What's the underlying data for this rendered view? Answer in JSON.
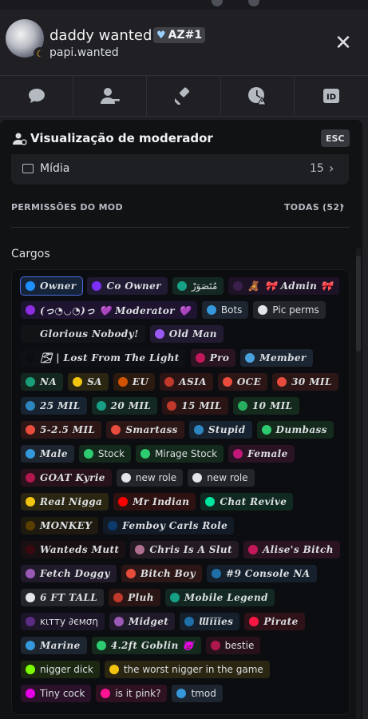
{
  "profile": {
    "display_name": "daddy wanted",
    "tag": "AZ#1",
    "username": "papi.wanted",
    "status_icon": "moon-idle-icon"
  },
  "tabs": [
    {
      "name": "chat-bubble-icon"
    },
    {
      "name": "user-remove-icon"
    },
    {
      "name": "gavel-icon"
    },
    {
      "name": "timeout-clock-icon"
    },
    {
      "name": "id-icon",
      "label": "ID"
    }
  ],
  "moderator_view": {
    "title": "Visualização de moderador",
    "esc_label": "ESC",
    "media_label": "Mídia",
    "media_count": "15",
    "permissions_label": "PERMISSÕES DO MOD",
    "permissions_all": "TODAS (52)",
    "cargos_label": "Cargos"
  },
  "roles": [
    {
      "label": "Owner",
      "color": "#1e90ff",
      "fancy": true,
      "bg": "#16243a",
      "selected": true
    },
    {
      "label": "Co Owner",
      "color": "#7b2ff7",
      "fancy": true,
      "bg": "#201a33"
    },
    {
      "label": "مُتَصَوَرْ",
      "color": "#16a085",
      "fancy": false,
      "bg": "#132822"
    },
    {
      "label": "🎀 Admin 🎀",
      "color": "#3a1f4a",
      "fancy": true,
      "bg": "#1d1226",
      "prefix": "🧸"
    },
    {
      "label": "(っ◔◡◔)っ 💜 Moderator 💜",
      "color": "#8e2de2",
      "fancy": true,
      "bg": "#1e1430"
    },
    {
      "label": "Bots",
      "color": "#3498db",
      "fancy": false,
      "bg": "#1c2530"
    },
    {
      "label": "Pic perms",
      "color": "#e3e5e8",
      "fancy": false,
      "bg": "#23252b"
    },
    {
      "label": "Glorious Nobody!",
      "color": "#111214",
      "fancy": true,
      "bg": "#121316"
    },
    {
      "label": "Old Man",
      "color": "#9b59f6",
      "fancy": true,
      "bg": "#211a30"
    },
    {
      "label": "🌫 | Lost From The Light",
      "color": "#0c0d10",
      "fancy": true,
      "bg": "#0f1013"
    },
    {
      "label": "Pro",
      "color": "#c2185b",
      "fancy": true,
      "bg": "#2a1420"
    },
    {
      "label": "Member",
      "color": "#4aa3df",
      "fancy": true,
      "bg": "#1b2632"
    },
    {
      "label": "NA",
      "color": "#1a9e7a",
      "fancy": true,
      "bg": "#14271f"
    },
    {
      "label": "SA",
      "color": "#f1c40f",
      "fancy": true,
      "bg": "#2a2612"
    },
    {
      "label": "EU",
      "color": "#d35400",
      "fancy": true,
      "bg": "#2a1a10"
    },
    {
      "label": "ASIA",
      "color": "#c0392b",
      "fancy": true,
      "bg": "#2a1514"
    },
    {
      "label": "OCE",
      "color": "#e74c3c",
      "fancy": true,
      "bg": "#2c1616"
    },
    {
      "label": "30 MIL",
      "color": "#e74c3c",
      "fancy": true,
      "bg": "#2c1616"
    },
    {
      "label": "25 MIL",
      "color": "#2e86c1",
      "fancy": true,
      "bg": "#172330"
    },
    {
      "label": "20 MIL",
      "color": "#16a085",
      "fancy": true,
      "bg": "#132822"
    },
    {
      "label": "15 MIL",
      "color": "#c0392b",
      "fancy": true,
      "bg": "#2a1514"
    },
    {
      "label": "10 MIL",
      "color": "#27ae60",
      "fancy": true,
      "bg": "#142a1c"
    },
    {
      "label": "5-2.5 MIL",
      "color": "#e74c3c",
      "fancy": true,
      "bg": "#2c1616"
    },
    {
      "label": "Smartass",
      "color": "#e74c3c",
      "fancy": true,
      "bg": "#2c1616"
    },
    {
      "label": "Stupid",
      "color": "#2e86c1",
      "fancy": true,
      "bg": "#172330"
    },
    {
      "label": "Dumbass",
      "color": "#2ecc71",
      "fancy": true,
      "bg": "#142a1c"
    },
    {
      "label": "Male",
      "color": "#3498db",
      "fancy": true,
      "bg": "#1c2530"
    },
    {
      "label": "Stock",
      "color": "#2ecc71",
      "fancy": false,
      "bg": "#142a1c"
    },
    {
      "label": "Mirage Stock",
      "color": "#2ecc71",
      "fancy": false,
      "bg": "#142a1c"
    },
    {
      "label": "Female",
      "color": "#c2187a",
      "fancy": true,
      "bg": "#2a1424"
    },
    {
      "label": "GOAT Kyrie",
      "color": "#b0174f",
      "fancy": true,
      "bg": "#27121c"
    },
    {
      "label": "new role",
      "color": "#e3e5e8",
      "fancy": false,
      "bg": "#23252b"
    },
    {
      "label": "new role",
      "color": "#e3e5e8",
      "fancy": false,
      "bg": "#23252b"
    },
    {
      "label": "Real Nigga",
      "color": "#f1c40f",
      "fancy": true,
      "bg": "#2a2612"
    },
    {
      "label": "Mr Indian",
      "color": "#ff0000",
      "fancy": true,
      "bg": "#2e1212"
    },
    {
      "label": "Chat Revive",
      "color": "#00e5a0",
      "fancy": true,
      "bg": "#102a22"
    },
    {
      "label": "MONKEY",
      "color": "#5a3e00",
      "fancy": true,
      "bg": "#1e1a10"
    },
    {
      "label": "Femboy Carls Role",
      "color": "#0b3a6b",
      "fancy": true,
      "bg": "#121a26"
    },
    {
      "label": "Wanteds Mutt",
      "color": "#3a0a10",
      "fancy": true,
      "bg": "#181013"
    },
    {
      "label": "Chris Is A Slut",
      "color": "#b07090",
      "fancy": true,
      "bg": "#241a22"
    },
    {
      "label": "Alise's Bitch",
      "color": "#c2185b",
      "fancy": true,
      "bg": "#2a1420"
    },
    {
      "label": "Fetch Doggy",
      "color": "#9b59b6",
      "fancy": true,
      "bg": "#211a2a"
    },
    {
      "label": "Bitch Boy",
      "color": "#e74c3c",
      "fancy": true,
      "bg": "#2c1616"
    },
    {
      "label": "#9 Console NA",
      "color": "#1f6fa8",
      "fancy": true,
      "bg": "#15202c"
    },
    {
      "label": "6 FT TALL",
      "color": "#e3e5e8",
      "fancy": true,
      "bg": "#23252b"
    },
    {
      "label": "Pluh",
      "color": "#c0392b",
      "fancy": true,
      "bg": "#2a1514"
    },
    {
      "label": "Mobile Legend",
      "color": "#16a085",
      "fancy": true,
      "bg": "#132822"
    },
    {
      "label": "ĸιттy ∂ємση",
      "color": "#5b2c83",
      "fancy": false,
      "bg": "#1d1528"
    },
    {
      "label": "Midget",
      "color": "#9b59b6",
      "fancy": true,
      "bg": "#211a2a"
    },
    {
      "label": "Ɯĭĭĭes",
      "color": "#1f6fa8",
      "fancy": true,
      "bg": "#15202c"
    },
    {
      "label": "Pirate",
      "color": "#ff1744",
      "fancy": true,
      "bg": "#2e1218"
    },
    {
      "label": "Marine",
      "color": "#3498db",
      "fancy": true,
      "bg": "#1c2530"
    },
    {
      "label": "4.2ft Goblin 👿",
      "color": "#2ecc71",
      "fancy": true,
      "bg": "#142a1c"
    },
    {
      "label": "bestie",
      "color": "#b0174f",
      "fancy": false,
      "bg": "#27121c"
    },
    {
      "label": "nigger dick",
      "color": "#7cfc00",
      "fancy": false,
      "bg": "#1c2812"
    },
    {
      "label": "the worst nigger in the game",
      "color": "#f1c40f",
      "fancy": false,
      "bg": "#2a2612"
    },
    {
      "label": "Tiny cock",
      "color": "#e600e6",
      "fancy": false,
      "bg": "#2a122a"
    },
    {
      "label": "is it pink?",
      "color": "#ff1493",
      "fancy": false,
      "bg": "#2e1222"
    },
    {
      "label": "tmod",
      "color": "#3498db",
      "fancy": false,
      "bg": "#1c2530"
    }
  ]
}
